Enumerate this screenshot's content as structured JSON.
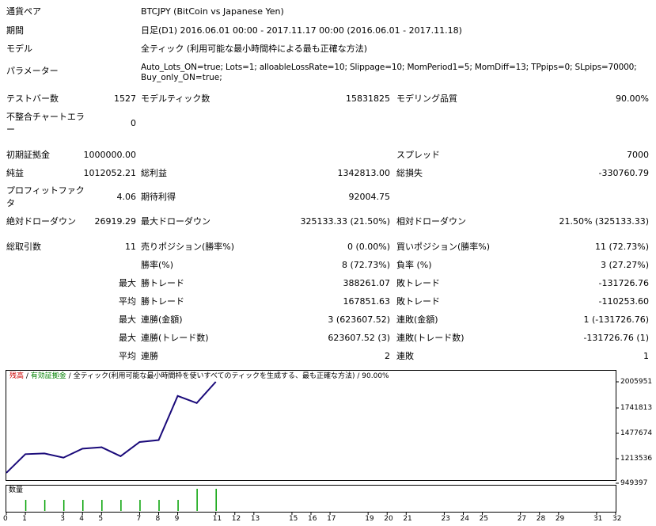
{
  "info": {
    "currency_pair_label": "通貨ペア",
    "currency_pair_value": "BTCJPY (BitCoin vs Japanese Yen)",
    "period_label": "期間",
    "period_value": "日足(D1) 2016.06.01 00:00 - 2017.11.17 00:00 (2016.06.01 - 2017.11.18)",
    "model_label": "モデル",
    "model_value": "全ティック (利用可能な最小時間枠による最も正確な方法)",
    "params_label": "パラメーター",
    "params_line1": "Auto_Lots_ON=true; Lots=1; alloableLossRate=10; Slippage=10; MomPeriod1=5; MomDiff=13; TPpips=0; SLpips=70000;",
    "params_line2": "Buy_only_ON=true;"
  },
  "stats": {
    "test_bars_label": "テストバー数",
    "test_bars_value": "1527",
    "model_ticks_label": "モデルティック数",
    "model_ticks_value": "15831825",
    "modeling_quality_label": "モデリング品質",
    "modeling_quality_value": "90.00%",
    "mismatch_label_1": "不整合チャートエラ",
    "mismatch_label_2": "ー",
    "mismatch_value": "0",
    "initial_deposit_label": "初期証拠金",
    "initial_deposit_value": "1000000.00",
    "spread_label": "スプレッド",
    "spread_value": "7000",
    "net_profit_label": "純益",
    "net_profit_value": "1012052.21",
    "gross_profit_label": "総利益",
    "gross_profit_value": "1342813.00",
    "gross_loss_label": "総損失",
    "gross_loss_value": "-330760.79",
    "profit_factor_label_1": "プロフィットファク",
    "profit_factor_label_2": "タ",
    "profit_factor_value": "4.06",
    "expected_payoff_label": "期待利得",
    "expected_payoff_value": "92004.75",
    "abs_drawdown_label": "絶対ドローダウン",
    "abs_drawdown_value": "26919.29",
    "max_drawdown_label": "最大ドローダウン",
    "max_drawdown_value": "325133.33 (21.50%)",
    "rel_drawdown_label": "相対ドローダウン",
    "rel_drawdown_value": "21.50% (325133.33)",
    "total_trades_label": "総取引数",
    "total_trades_value": "11",
    "short_pos_label": "売りポジション(勝率%)",
    "short_pos_value": "0 (0.00%)",
    "long_pos_label": "買いポジション(勝率%)",
    "long_pos_value": "11 (72.73%)",
    "win_rate_label": "勝率(%)",
    "win_rate_value": "8 (72.73%)",
    "loss_rate_label": "負率 (%)",
    "loss_rate_value": "3 (27.27%)",
    "max_label": "最大",
    "avg_label": "平均",
    "max_win_trade_label": "勝トレード",
    "max_win_trade_value": "388261.07",
    "max_loss_trade_label": "敗トレード",
    "max_loss_trade_value": "-131726.76",
    "avg_win_trade_label": "勝トレード",
    "avg_win_trade_value": "167851.63",
    "avg_loss_trade_label": "敗トレード",
    "avg_loss_trade_value": "-110253.60",
    "max_consec_wins_amt_label": "連勝(金額)",
    "max_consec_wins_amt_value": "3 (623607.52)",
    "max_consec_losses_amt_label": "連敗(金額)",
    "max_consec_losses_amt_value": "1 (-131726.76)",
    "max_consec_wins_cnt_label": "連勝(トレード数)",
    "max_consec_wins_cnt_value": "623607.52 (3)",
    "max_consec_losses_cnt_label": "連敗(トレード数)",
    "max_consec_losses_cnt_value": "-131726.76 (1)",
    "avg_consec_wins_label": "連勝",
    "avg_consec_wins_value": "2",
    "avg_consec_losses_label": "連敗",
    "avg_consec_losses_value": "1"
  },
  "legend": {
    "balance": "残高",
    "sep1": " / ",
    "equity": "有効証拠金",
    "sep2": " / ",
    "rest": "全ティック(利用可能な最小時間枠を使いすべてのティックを生成する、最も正確な方法)",
    "sep3": " / ",
    "quality": "90.00%"
  },
  "volume_label": "数量",
  "colors": {
    "balance_line": "#1a0a7a",
    "volume_bar": "#00a000",
    "balance_legend": "#cc0000",
    "equity_legend": "#008000"
  },
  "chart_data": {
    "type": "line",
    "series": [
      {
        "name": "残高",
        "x": [
          0,
          1,
          2,
          3,
          4,
          5,
          6,
          7,
          8,
          9,
          10,
          11
        ],
        "values": [
          1000000,
          1197000,
          1205000,
          1160000,
          1255000,
          1270000,
          1175000,
          1325000,
          1345000,
          1810000,
          1735000,
          2012052
        ]
      }
    ],
    "ylim": [
      949397,
      2100000
    ],
    "yticks": [
      "2005951",
      "1741813",
      "1477674",
      "1213536",
      "949397"
    ],
    "xticks": [
      "0",
      "1",
      "3",
      "4",
      "5",
      "7",
      "8",
      "9",
      "11",
      "12",
      "13",
      "15",
      "16",
      "17",
      "19",
      "20",
      "21",
      "23",
      "24",
      "25",
      "27",
      "28",
      "29",
      "31",
      "32"
    ],
    "volume": {
      "x": [
        1,
        2,
        3,
        4,
        5,
        6,
        7,
        8,
        9,
        10,
        11
      ],
      "values": [
        1,
        1,
        1,
        1,
        1,
        1,
        1,
        1,
        1,
        2,
        2
      ]
    }
  }
}
